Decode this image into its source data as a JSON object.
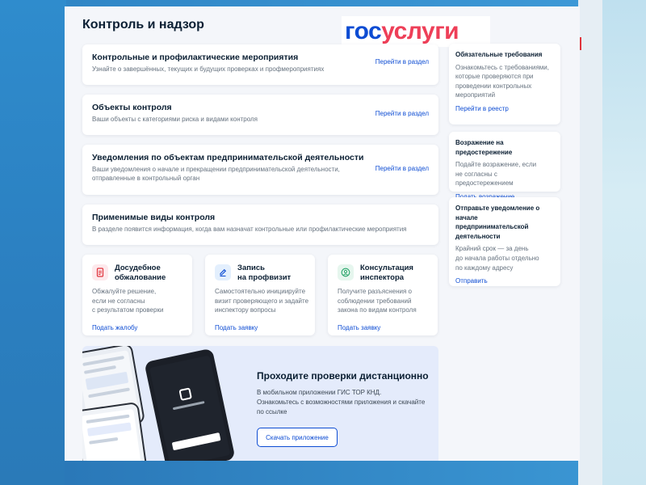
{
  "page": {
    "title": "Контроль и надзор"
  },
  "logo": {
    "part1": "гос",
    "part2": "услуги"
  },
  "sections": [
    {
      "title": "Контрольные и профилактические мероприятия",
      "desc": "Узнайте о завершённых, текущих и будущих проверках и профмероприятиях",
      "link": "Перейти в раздел"
    },
    {
      "title": "Объекты контроля",
      "desc": "Ваши объекты с категориями риска и видами контроля",
      "link": "Перейти в раздел"
    },
    {
      "title": "Уведомления по объектам предпринимательской деятельности",
      "desc1": "Ваши уведомления о начале и прекращении предпринимательской деятельности,",
      "desc2": "отправленные в контрольный орган",
      "link": "Перейти в раздел"
    },
    {
      "title": "Применимые виды контроля",
      "desc": "В разделе появится информация, когда вам назначат контрольные или профилактические мероприятия"
    }
  ],
  "services": [
    {
      "title1": "Досудебное",
      "title2": "обжалование",
      "desc1": "Обжалуйте решение,",
      "desc2": "если не согласны",
      "desc3": "с результатом проверки",
      "link": "Подать жалобу",
      "icon": "document-icon",
      "color": "#fde9ec",
      "iconColor": "#e0343c"
    },
    {
      "title1": "Запись",
      "title2": "на профвизит",
      "desc1": "Самостоятельно инициируйте",
      "desc2": "визит проверяющего и задайте",
      "desc3": "инспектору вопросы",
      "link": "Подать заявку",
      "icon": "pen-icon",
      "color": "#e3effd",
      "iconColor": "#0d4cd3"
    },
    {
      "title1": "Консультация",
      "title2": "инспектора",
      "desc1": "Получите разъяснения о",
      "desc2": "соблюдении требований",
      "desc3": "закона по видам контроля",
      "link": "Подать заявку",
      "icon": "user-icon",
      "color": "#e6f6ee",
      "iconColor": "#2aa66b"
    }
  ],
  "sidebar": [
    {
      "title": "Обязательные требования",
      "d1": "Ознакомьтесь с требованиями,",
      "d2": "которые проверяются при",
      "d3": "проведении контрольных",
      "d4": "мероприятий",
      "link": "Перейти в реестр"
    },
    {
      "title": "Возражение на предостережение",
      "d1": "Подайте возражение, если",
      "d2": "не согласны с предостережением",
      "link": "Подать возражение"
    },
    {
      "t1": "Отправьте уведомление о начале",
      "t2": "предпринимательской",
      "t3": "деятельности",
      "d1": "Крайний срок — за день",
      "d2": "до начала работы отдельно",
      "d3": "по каждому адресу",
      "link": "Отправить"
    }
  ],
  "promo": {
    "title": "Проходите проверки дистанционно",
    "d1": "В мобильном приложении ГИС ТОР КНД.",
    "d2": "Ознакомьтесь с возможностями приложения и скачайте",
    "d3": "по ссылке",
    "button": "Скачать приложение"
  },
  "colors": {
    "brandBlue": "#0d4cd3",
    "brandRed": "#ee3f58",
    "text": "#0b1f33",
    "muted": "#66727f"
  }
}
